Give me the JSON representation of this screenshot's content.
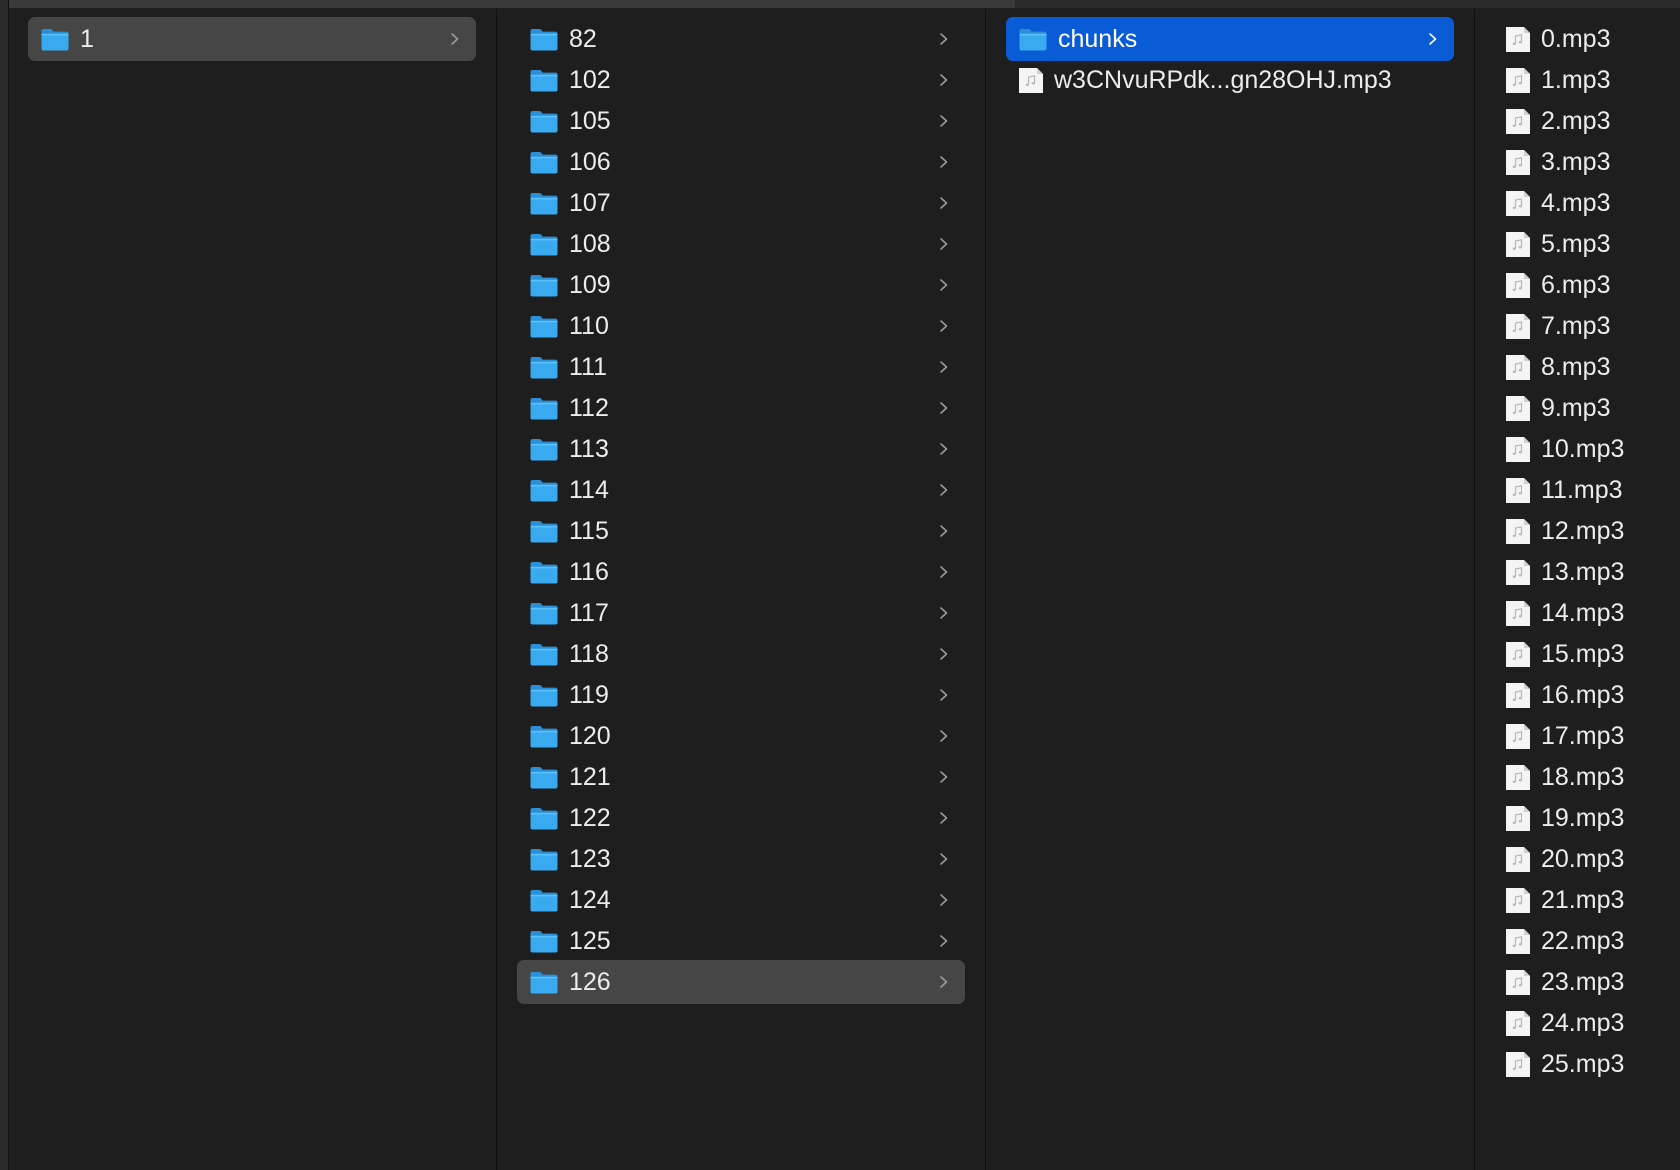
{
  "columns": [
    {
      "items": [
        {
          "label": "1",
          "kind": "folder",
          "state": "inactive-selected"
        }
      ]
    },
    {
      "items": [
        {
          "label": "82",
          "kind": "folder"
        },
        {
          "label": "102",
          "kind": "folder"
        },
        {
          "label": "105",
          "kind": "folder"
        },
        {
          "label": "106",
          "kind": "folder"
        },
        {
          "label": "107",
          "kind": "folder"
        },
        {
          "label": "108",
          "kind": "folder"
        },
        {
          "label": "109",
          "kind": "folder"
        },
        {
          "label": "110",
          "kind": "folder"
        },
        {
          "label": "111",
          "kind": "folder"
        },
        {
          "label": "112",
          "kind": "folder"
        },
        {
          "label": "113",
          "kind": "folder"
        },
        {
          "label": "114",
          "kind": "folder"
        },
        {
          "label": "115",
          "kind": "folder"
        },
        {
          "label": "116",
          "kind": "folder"
        },
        {
          "label": "117",
          "kind": "folder"
        },
        {
          "label": "118",
          "kind": "folder"
        },
        {
          "label": "119",
          "kind": "folder"
        },
        {
          "label": "120",
          "kind": "folder"
        },
        {
          "label": "121",
          "kind": "folder"
        },
        {
          "label": "122",
          "kind": "folder"
        },
        {
          "label": "123",
          "kind": "folder"
        },
        {
          "label": "124",
          "kind": "folder"
        },
        {
          "label": "125",
          "kind": "folder"
        },
        {
          "label": "126",
          "kind": "folder",
          "state": "inactive-selected"
        }
      ]
    },
    {
      "items": [
        {
          "label": "chunks",
          "kind": "folder",
          "state": "active-selected"
        },
        {
          "label": "w3CNvuRPdk...gn28OHJ.mp3",
          "kind": "audio-file"
        }
      ]
    },
    {
      "items": [
        {
          "label": "0.mp3",
          "kind": "audio-file"
        },
        {
          "label": "1.mp3",
          "kind": "audio-file"
        },
        {
          "label": "2.mp3",
          "kind": "audio-file"
        },
        {
          "label": "3.mp3",
          "kind": "audio-file"
        },
        {
          "label": "4.mp3",
          "kind": "audio-file"
        },
        {
          "label": "5.mp3",
          "kind": "audio-file"
        },
        {
          "label": "6.mp3",
          "kind": "audio-file"
        },
        {
          "label": "7.mp3",
          "kind": "audio-file"
        },
        {
          "label": "8.mp3",
          "kind": "audio-file"
        },
        {
          "label": "9.mp3",
          "kind": "audio-file"
        },
        {
          "label": "10.mp3",
          "kind": "audio-file"
        },
        {
          "label": "11.mp3",
          "kind": "audio-file"
        },
        {
          "label": "12.mp3",
          "kind": "audio-file"
        },
        {
          "label": "13.mp3",
          "kind": "audio-file"
        },
        {
          "label": "14.mp3",
          "kind": "audio-file"
        },
        {
          "label": "15.mp3",
          "kind": "audio-file"
        },
        {
          "label": "16.mp3",
          "kind": "audio-file"
        },
        {
          "label": "17.mp3",
          "kind": "audio-file"
        },
        {
          "label": "18.mp3",
          "kind": "audio-file"
        },
        {
          "label": "19.mp3",
          "kind": "audio-file"
        },
        {
          "label": "20.mp3",
          "kind": "audio-file"
        },
        {
          "label": "21.mp3",
          "kind": "audio-file"
        },
        {
          "label": "22.mp3",
          "kind": "audio-file"
        },
        {
          "label": "23.mp3",
          "kind": "audio-file"
        },
        {
          "label": "24.mp3",
          "kind": "audio-file"
        },
        {
          "label": "25.mp3",
          "kind": "audio-file"
        }
      ]
    }
  ],
  "colors": {
    "background": "#1e1e1e",
    "active_selection": "#0a5bd6",
    "inactive_selection": "#464646",
    "folder_blue": "#38a9ee",
    "text": "#ececec"
  }
}
